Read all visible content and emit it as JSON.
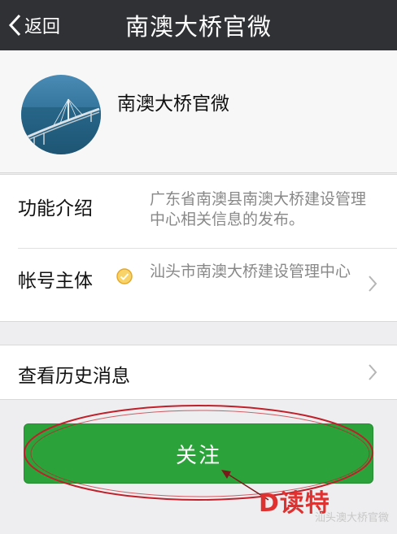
{
  "nav": {
    "back_label": "返回",
    "title": "南澳大桥官微"
  },
  "profile": {
    "name": "南澳大桥官微"
  },
  "info": {
    "intro_label": "功能介绍",
    "intro_value": "广东省南澳县南澳大桥建设管理中心相关信息的发布。",
    "owner_label": "帐号主体",
    "owner_value": "汕头市南澳大桥建设管理中心"
  },
  "history": {
    "label": "查看历史消息"
  },
  "action": {
    "follow_label": "关注"
  },
  "watermark": {
    "logo_text": "D读特",
    "text": "汕头澳大桥官微"
  },
  "colors": {
    "nav_bg": "#2f3135",
    "button_green": "#2ba23a",
    "annotation_red": "#c0202a",
    "verified_gold": "#e5a92a"
  }
}
